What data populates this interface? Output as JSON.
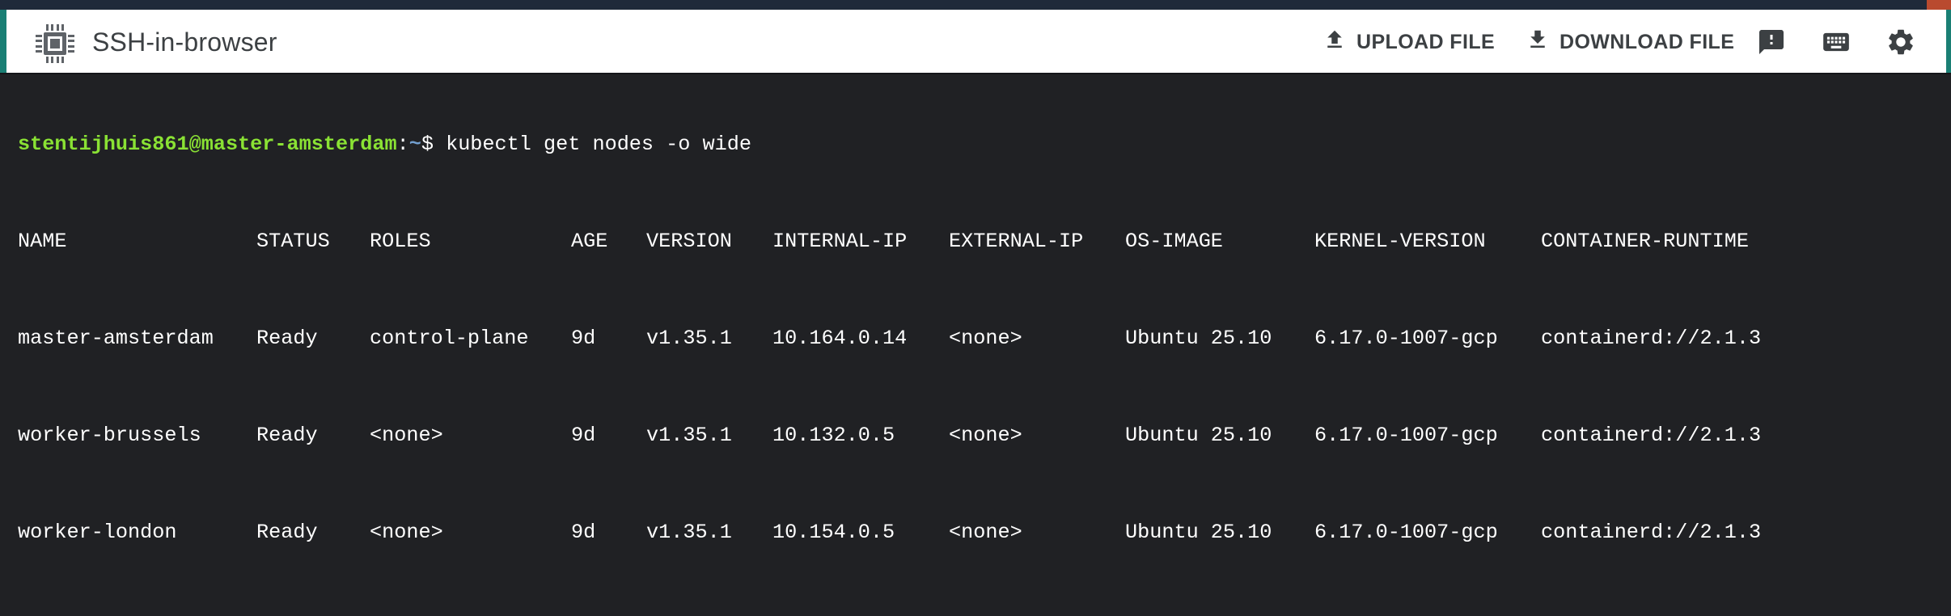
{
  "app": {
    "title": "SSH-in-browser",
    "icon": "chip-icon"
  },
  "toolbar": {
    "upload_label": "UPLOAD FILE",
    "upload_icon": "upload-icon",
    "download_label": "DOWNLOAD FILE",
    "download_icon": "download-icon",
    "feedback_icon": "feedback-icon",
    "keyboard_icon": "keyboard-icon",
    "settings_icon": "gear-icon"
  },
  "colors": {
    "header_bg": "#ffffff",
    "terminal_bg": "#202124",
    "prompt_user": "#8ae234",
    "prompt_path": "#729fcf",
    "accent_edge": "#1a7f74"
  },
  "terminal": {
    "prompt": {
      "user_host": "stentijhuis861@master-amsterdam",
      "separator": ":",
      "path": "~",
      "symbol": "$"
    },
    "command": "kubectl get nodes -o wide",
    "headers": [
      "NAME",
      "STATUS",
      "ROLES",
      "AGE",
      "VERSION",
      "INTERNAL-IP",
      "EXTERNAL-IP",
      "OS-IMAGE",
      "KERNEL-VERSION",
      "CONTAINER-RUNTIME"
    ],
    "rows": [
      [
        "master-amsterdam",
        "Ready",
        "control-plane",
        "9d",
        "v1.35.1",
        "10.164.0.14",
        "<none>",
        "Ubuntu 25.10",
        "6.17.0-1007-gcp",
        "containerd://2.1.3"
      ],
      [
        "worker-brussels",
        "Ready",
        "<none>",
        "9d",
        "v1.35.1",
        "10.132.0.5",
        "<none>",
        "Ubuntu 25.10",
        "6.17.0-1007-gcp",
        "containerd://2.1.3"
      ],
      [
        "worker-london",
        "Ready",
        "<none>",
        "9d",
        "v1.35.1",
        "10.154.0.5",
        "<none>",
        "Ubuntu 25.10",
        "6.17.0-1007-gcp",
        "containerd://2.1.3"
      ]
    ]
  }
}
